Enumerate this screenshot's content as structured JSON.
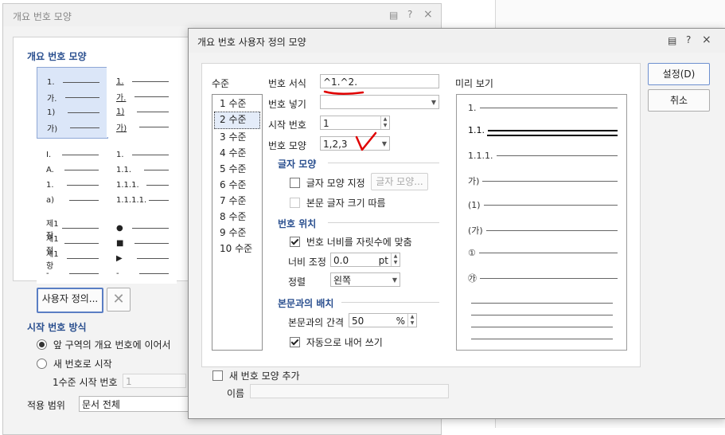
{
  "parent_dialog": {
    "title": "개요 번호 모양",
    "section_shape": "개요 번호 모양",
    "presets": [
      {
        "rows": [
          "1.",
          "가.",
          "1)",
          "가)"
        ],
        "underlined": false
      },
      {
        "rows": [
          "1.",
          "가.",
          "1)",
          "가)"
        ],
        "underlined": true
      },
      {
        "rows": [
          "I.",
          "A.",
          "1.",
          "a)"
        ],
        "underlined": false
      },
      {
        "rows": [
          "1.",
          "1.1.",
          "1.1.1.",
          "1.1.1.1."
        ],
        "underlined": false
      },
      {
        "rows": [
          "제1장",
          "제1절",
          "제1항",
          "-"
        ],
        "underlined": false
      },
      {
        "rows": [
          "●",
          "■",
          "▶",
          "-"
        ],
        "underlined": false
      }
    ],
    "custom_button": "사용자 정의...",
    "start_mode_title": "시작 번호 방식",
    "radio_continue": "앞 구역의 개요 번호에 이어서",
    "radio_new": "새 번호로 시작",
    "level1_start_label": "1수준 시작 번호",
    "level1_start_value": "1",
    "apply_label": "적용 범위",
    "apply_value": "문서 전체"
  },
  "dialog": {
    "title": "개요 번호 사용자 정의 모양",
    "levels_title": "수준",
    "levels": [
      "1 수준",
      "2 수준",
      "3 수준",
      "4 수준",
      "5 수준",
      "6 수준",
      "7 수준",
      "8 수준",
      "9 수준",
      "10 수준"
    ],
    "selected_level": 1,
    "number_format_label": "번호 서식",
    "number_format_value": "^1.^2.",
    "number_insert_label": "번호 넣기",
    "number_insert_value": "",
    "start_number_label": "시작 번호",
    "start_number_value": "1",
    "number_shape_label": "번호 모양",
    "number_shape_value": "1,2,3",
    "char_shape_title": "글자 모양",
    "char_shape_check": "글자 모양 지정",
    "char_shape_button": "글자 모양...",
    "follow_body_size": "본문 글자 크기 따름",
    "number_pos_title": "번호 위치",
    "auto_width_check": "번호 너비를 자릿수에 맞춤",
    "width_adjust_label": "너비 조정",
    "width_adjust_value": "0.0",
    "width_adjust_unit": "pt",
    "align_label": "정렬",
    "align_value": "왼쪽",
    "body_layout_title": "본문과의 배치",
    "body_gap_label": "본문과의 간격",
    "body_gap_value": "50",
    "body_gap_unit": "%",
    "auto_hanging": "자동으로 내어 쓰기",
    "preview_title": "미리 보기",
    "preview_rows": [
      "1.",
      "1.1.",
      "1.1.1.",
      "가)",
      "(1)",
      "(가)",
      "①",
      "㉮"
    ],
    "add_new_shape": "새 번호 모양 추가",
    "name_label": "이름",
    "name_value": "",
    "ok_button": "설정(D)",
    "cancel_button": "취소"
  },
  "title_icons": {
    "help": "?",
    "close": "×"
  }
}
